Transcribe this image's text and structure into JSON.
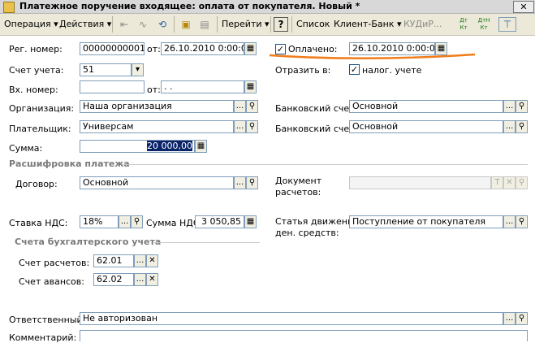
{
  "window": {
    "title": "Платежное поручение входящее: оплата от покупателя. Новый *",
    "close": "✕"
  },
  "toolbar": {
    "operation": "Операция",
    "actions": "Действия",
    "goto": "Перейти",
    "help": "?",
    "list": "Список",
    "bank_client": "Клиент-Банк",
    "kudir": "КУДиР...",
    "dt_kt_1": "Дт Кт",
    "dt_kt_2": "ДтН Кт",
    "dropdown_arrow": "▾"
  },
  "form": {
    "reg_number": {
      "label": "Рег. номер:",
      "value": "00000000001",
      "from_label": "от:",
      "date": "26.10.2010  0:00:00"
    },
    "paid": {
      "label": "Оплачено:",
      "checked": true,
      "date": "26.10.2010  0:00:00"
    },
    "account": {
      "label": "Счет учета:",
      "value": "51"
    },
    "reflect": {
      "label": "Отразить в:",
      "checkbox_label": "налог. учете",
      "checked": true
    },
    "in_number": {
      "label": "Вх. номер:",
      "value": "",
      "from_label": "от:",
      "date": " .  ."
    },
    "organization": {
      "label": "Организация:",
      "value": "Наша организация"
    },
    "bank_account_1": {
      "label": "Банковский счет:",
      "value": "Основной"
    },
    "payer": {
      "label": "Плательщик:",
      "value": "Универсам"
    },
    "bank_account_2": {
      "label": "Банковский счет:",
      "value": "Основной"
    },
    "sum": {
      "label": "Сумма:",
      "value": "20 000,00"
    },
    "section_payment": "Расшифровка платежа",
    "contract": {
      "label": "Договор:",
      "value": "Основной"
    },
    "settlement_doc": {
      "label": "Документ\nрасчетов:",
      "value": ""
    },
    "vat_rate": {
      "label": "Ставка НДС:",
      "value": "18%"
    },
    "vat_sum": {
      "label": "Сумма НДС:",
      "value": "3 050,85"
    },
    "cash_flow": {
      "label": "Статья движения\nден. средств:",
      "value": "Поступление от покупателя"
    },
    "section_accounts": "Счета бухгалтерского учета",
    "settlement_account": {
      "label": "Счет расчетов:",
      "value": "62.01"
    },
    "advance_account": {
      "label": "Счет авансов:",
      "value": "62.02"
    },
    "responsible": {
      "label": "Ответственный:",
      "value": "Не авторизован"
    },
    "comment": {
      "label": "Комментарий:",
      "value": ""
    }
  },
  "icons": {
    "select": "...",
    "search": "⚲",
    "clear": "✕",
    "calendar": "▦",
    "calculator": "▦",
    "dropdown": "▾",
    "check": "✓",
    "t_icon": "T"
  },
  "colors": {
    "highlight_line": "#f07d1a",
    "selection": "#0a246a",
    "field_border": "#7f9db9"
  }
}
